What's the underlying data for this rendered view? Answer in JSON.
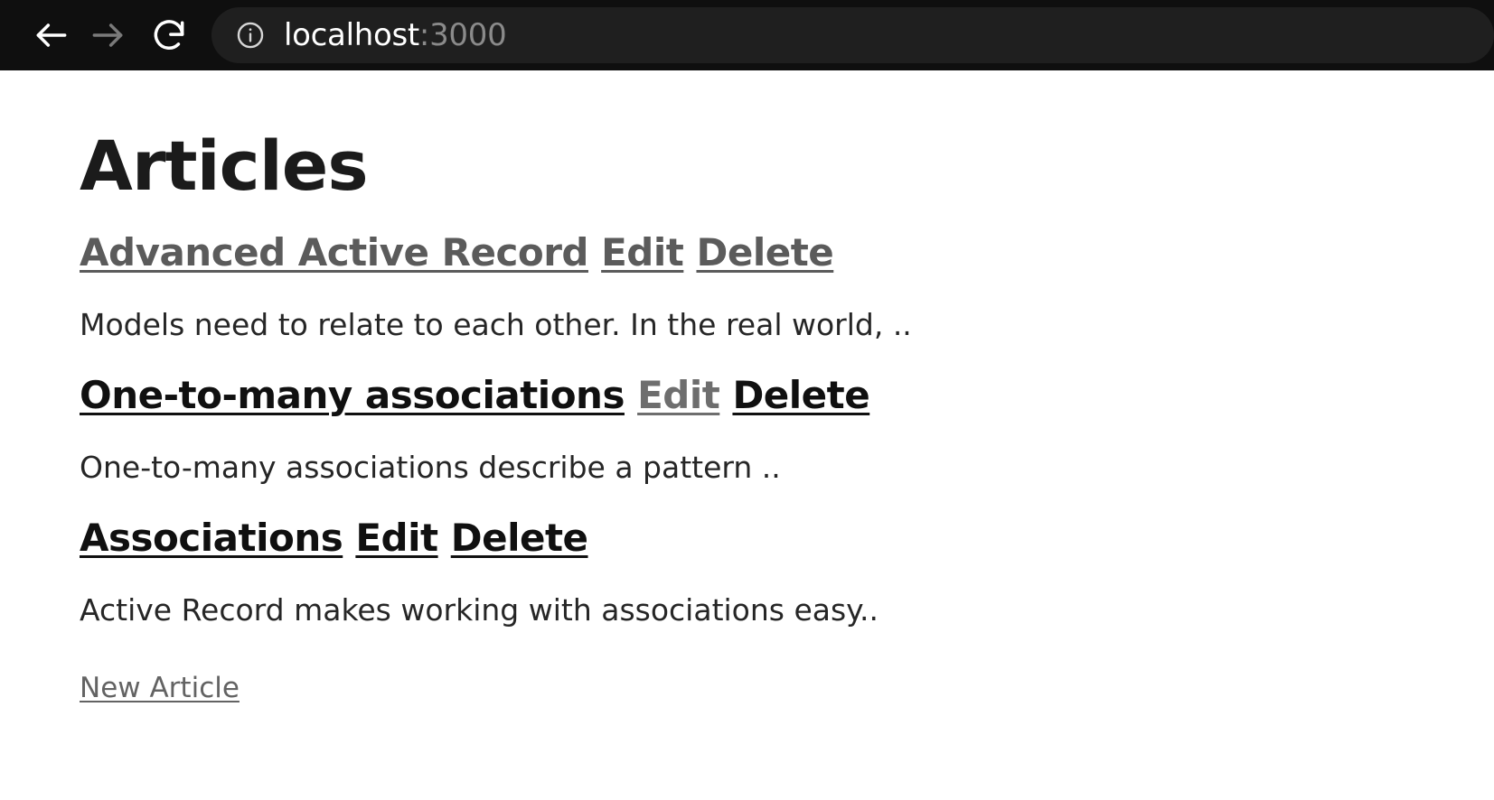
{
  "browser": {
    "back_icon": "arrow-left-icon",
    "forward_icon": "arrow-right-icon",
    "reload_icon": "reload-icon",
    "site_info_icon": "info-circle-icon",
    "url_host": "localhost",
    "url_port": ":3000",
    "url_full": "localhost:3000",
    "chrome_bg": "#0f0f0f",
    "omnibox_bg": "#1f1f1f"
  },
  "page": {
    "title": "Articles",
    "new_article_label": "New Article",
    "edit_label": "Edit",
    "delete_label": "Delete",
    "articles": [
      {
        "title": "Advanced Active Record",
        "body": "Models need to relate to each other. In the real world, ..",
        "title_state": "visited",
        "edit_state": "visited",
        "delete_state": "visited"
      },
      {
        "title": "One-to-many associations",
        "body": "One-to-many associations describe a pattern ..",
        "title_state": "unvisited",
        "edit_state": "visited",
        "delete_state": "unvisited"
      },
      {
        "title": "Associations",
        "body": "Active Record makes working with associations easy..",
        "title_state": "unvisited",
        "edit_state": "unvisited",
        "delete_state": "unvisited"
      }
    ]
  },
  "colors": {
    "link_unvisited": "#101010",
    "link_visited": "#5b5b5b",
    "text": "#262626",
    "heading": "#1b1b1b"
  }
}
